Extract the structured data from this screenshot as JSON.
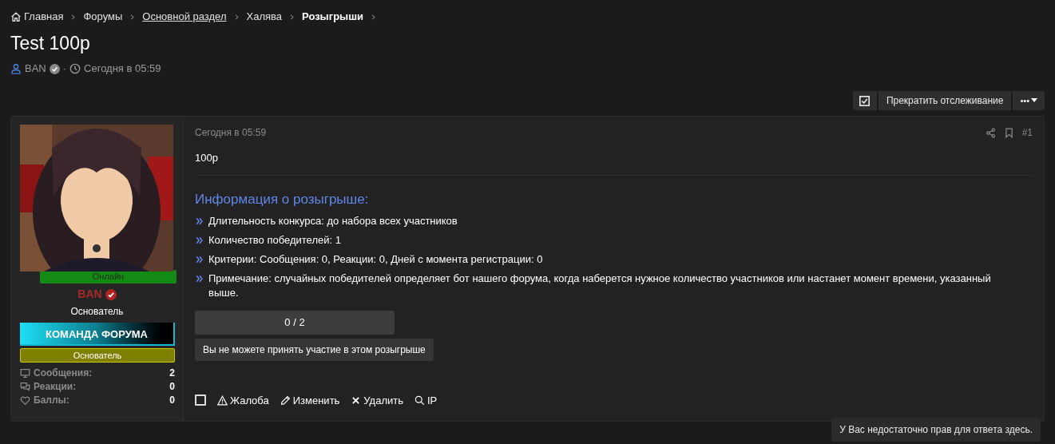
{
  "breadcrumbs": [
    {
      "label": "Главная",
      "kind": "home",
      "current": false,
      "underlined": false
    },
    {
      "label": "Форумы",
      "kind": "link",
      "current": false,
      "underlined": false
    },
    {
      "label": "Основной раздел",
      "kind": "link",
      "current": false,
      "underlined": true
    },
    {
      "label": "Халява",
      "kind": "link",
      "current": false,
      "underlined": false
    },
    {
      "label": "Розыгрыши",
      "kind": "link",
      "current": true,
      "underlined": false
    }
  ],
  "thread": {
    "title": "Test 100p",
    "author": "BAN",
    "verified": true,
    "separator": "·",
    "date": "Сегодня в 05:59"
  },
  "toolbar": {
    "watching": true,
    "watch_button": "Прекратить отслеживание",
    "more_button": "•••"
  },
  "post": {
    "user": {
      "online_badge": "Онлайн",
      "name": "BAN",
      "verified": true,
      "title": "Основатель",
      "banner": "КОМАНДА ФОРУМА",
      "role_badge": "Основатель",
      "stats": [
        {
          "label": "Сообщения:",
          "value": "2"
        },
        {
          "label": "Реакции:",
          "value": "0"
        },
        {
          "label": "Баллы:",
          "value": "0"
        }
      ]
    },
    "date": "Сегодня в 05:59",
    "number": "#1",
    "body": "100р",
    "giveaway": {
      "heading": "Информация о розыгрыше:",
      "items": [
        "Длительность конкурса: до набора всех участников",
        "Количество победителей: 1",
        "Критерии: Сообщения: 0, Реакции: 0, Дней с момента регистрации: 0",
        "Примечание: случайных победителей определяет бот нашего форума, когда наберется нужное количество участников или настанет момент времени, указанный выше."
      ],
      "progress": {
        "label": "0 / 2",
        "level": 0
      },
      "notice": "Вы не можете принять участие в этом розыгрыше"
    },
    "select_checked": false,
    "actions": [
      {
        "label": "Жалоба"
      },
      {
        "label": "Изменить"
      },
      {
        "label": "Удалить"
      },
      {
        "label": "IP"
      }
    ]
  },
  "reply_notice": "У Вас недостаточно прав для ответа здесь."
}
